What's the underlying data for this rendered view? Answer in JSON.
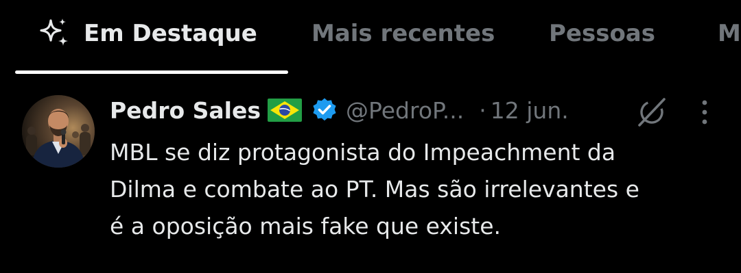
{
  "tabs": [
    {
      "label": "Em Destaque",
      "active": true,
      "icon": "sparkle-icon"
    },
    {
      "label": "Mais recentes",
      "active": false
    },
    {
      "label": "Pessoas",
      "active": false
    },
    {
      "label": "M",
      "active": false
    }
  ],
  "post": {
    "author": {
      "name": "Pedro Sales",
      "flag": "brazil-flag-icon",
      "verified": true,
      "handle": "@PedroP..."
    },
    "separator": "·",
    "date": "12 jun.",
    "text": "MBL se diz protagonista do Impeachment da\nDilma e combate ao PT. Mas são irrelevantes e\né a oposição mais fake que existe."
  },
  "colors": {
    "background": "#000000",
    "primary_text": "#e7e9ea",
    "secondary_text": "#71767b",
    "verified_blue": "#1d9bf0",
    "active_tab_indicator": "#ffffff"
  }
}
